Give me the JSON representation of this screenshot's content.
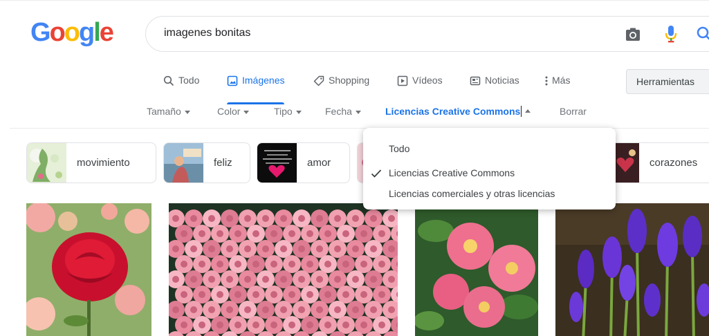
{
  "search": {
    "query": "imagenes bonitas",
    "logo_letters": [
      {
        "ch": "G",
        "color": "#4285F4"
      },
      {
        "ch": "o",
        "color": "#EA4335"
      },
      {
        "ch": "o",
        "color": "#FBBC05"
      },
      {
        "ch": "g",
        "color": "#4285F4"
      },
      {
        "ch": "l",
        "color": "#34A853"
      },
      {
        "ch": "e",
        "color": "#EA4335"
      }
    ]
  },
  "tabs": [
    {
      "label": "Todo",
      "icon": "search-icon",
      "active": false
    },
    {
      "label": "Imágenes",
      "icon": "image-icon",
      "active": true
    },
    {
      "label": "Shopping",
      "icon": "tag-icon",
      "active": false
    },
    {
      "label": "Vídeos",
      "icon": "play-icon",
      "active": false
    },
    {
      "label": "Noticias",
      "icon": "news-icon",
      "active": false
    },
    {
      "label": "Más",
      "icon": "more-vertical-icon",
      "active": false
    }
  ],
  "tools_label": "Herramientas",
  "filters": [
    {
      "label": "Tamaño"
    },
    {
      "label": "Color"
    },
    {
      "label": "Tipo"
    },
    {
      "label": "Fecha"
    },
    {
      "label": "Licencias Creative Commons",
      "active": true
    },
    {
      "label": "Borrar"
    }
  ],
  "chips": [
    {
      "label": "movimiento"
    },
    {
      "label": "feliz"
    },
    {
      "label": "amor"
    },
    {
      "label": "corazones"
    }
  ],
  "dropdown": {
    "items": [
      {
        "label": "Todo",
        "checked": false
      },
      {
        "label": "Licencias Creative Commons",
        "checked": true
      },
      {
        "label": "Licencias comerciales y otras licencias",
        "checked": false
      }
    ]
  },
  "colors": {
    "accent": "#1a73e8",
    "text_secondary": "#70757a",
    "text_primary": "#3c4043"
  }
}
